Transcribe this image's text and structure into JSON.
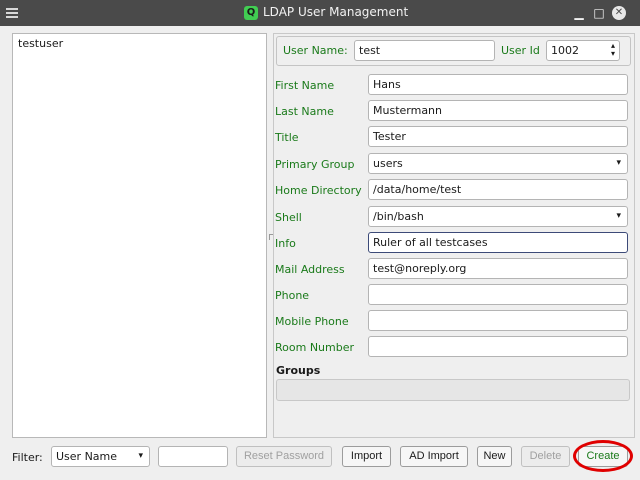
{
  "window": {
    "title": "LDAP User Management",
    "app_icon_glyph": "Q",
    "minimize_glyph": "▁",
    "maximize_glyph": "□",
    "close_glyph": "✕"
  },
  "users": [
    "testuser"
  ],
  "form": {
    "user_name_label": "User Name:",
    "user_name_value": "test",
    "user_id_label": "User Id",
    "user_id_value": "1002",
    "fields": [
      {
        "label": "First Name",
        "value": "Hans",
        "kind": "text"
      },
      {
        "label": "Last Name",
        "value": "Mustermann",
        "kind": "text"
      },
      {
        "label": "Title",
        "value": "Tester",
        "kind": "text"
      },
      {
        "label": "Primary Group",
        "value": "users",
        "kind": "combo"
      },
      {
        "label": "Home Directory",
        "value": "/data/home/test",
        "kind": "text"
      },
      {
        "label": "Shell",
        "value": "/bin/bash",
        "kind": "combo"
      },
      {
        "label": "Info",
        "value": "Ruler of all testcases",
        "kind": "text",
        "focused": true
      },
      {
        "label": "Mail Address",
        "value": "test@noreply.org",
        "kind": "text"
      },
      {
        "label": "Phone",
        "value": "",
        "kind": "text"
      },
      {
        "label": "Mobile Phone",
        "value": "",
        "kind": "text"
      },
      {
        "label": "Room Number",
        "value": "",
        "kind": "text"
      }
    ],
    "groups_label": "Groups"
  },
  "bottom": {
    "filter_label": "Filter:",
    "filter_field_value": "User Name",
    "filter_text_value": "",
    "buttons": {
      "reset_password": "Reset Password",
      "import": "Import",
      "ad_import": "AD Import",
      "new": "New",
      "delete": "Delete",
      "create": "Create"
    }
  },
  "colors": {
    "label_green": "#1a7a1a",
    "titlebar": "#4a4a4a",
    "highlight": "#e00000"
  },
  "icons": {
    "combo_arrow": "▾",
    "spin_up": "▴",
    "spin_down": "▾"
  }
}
